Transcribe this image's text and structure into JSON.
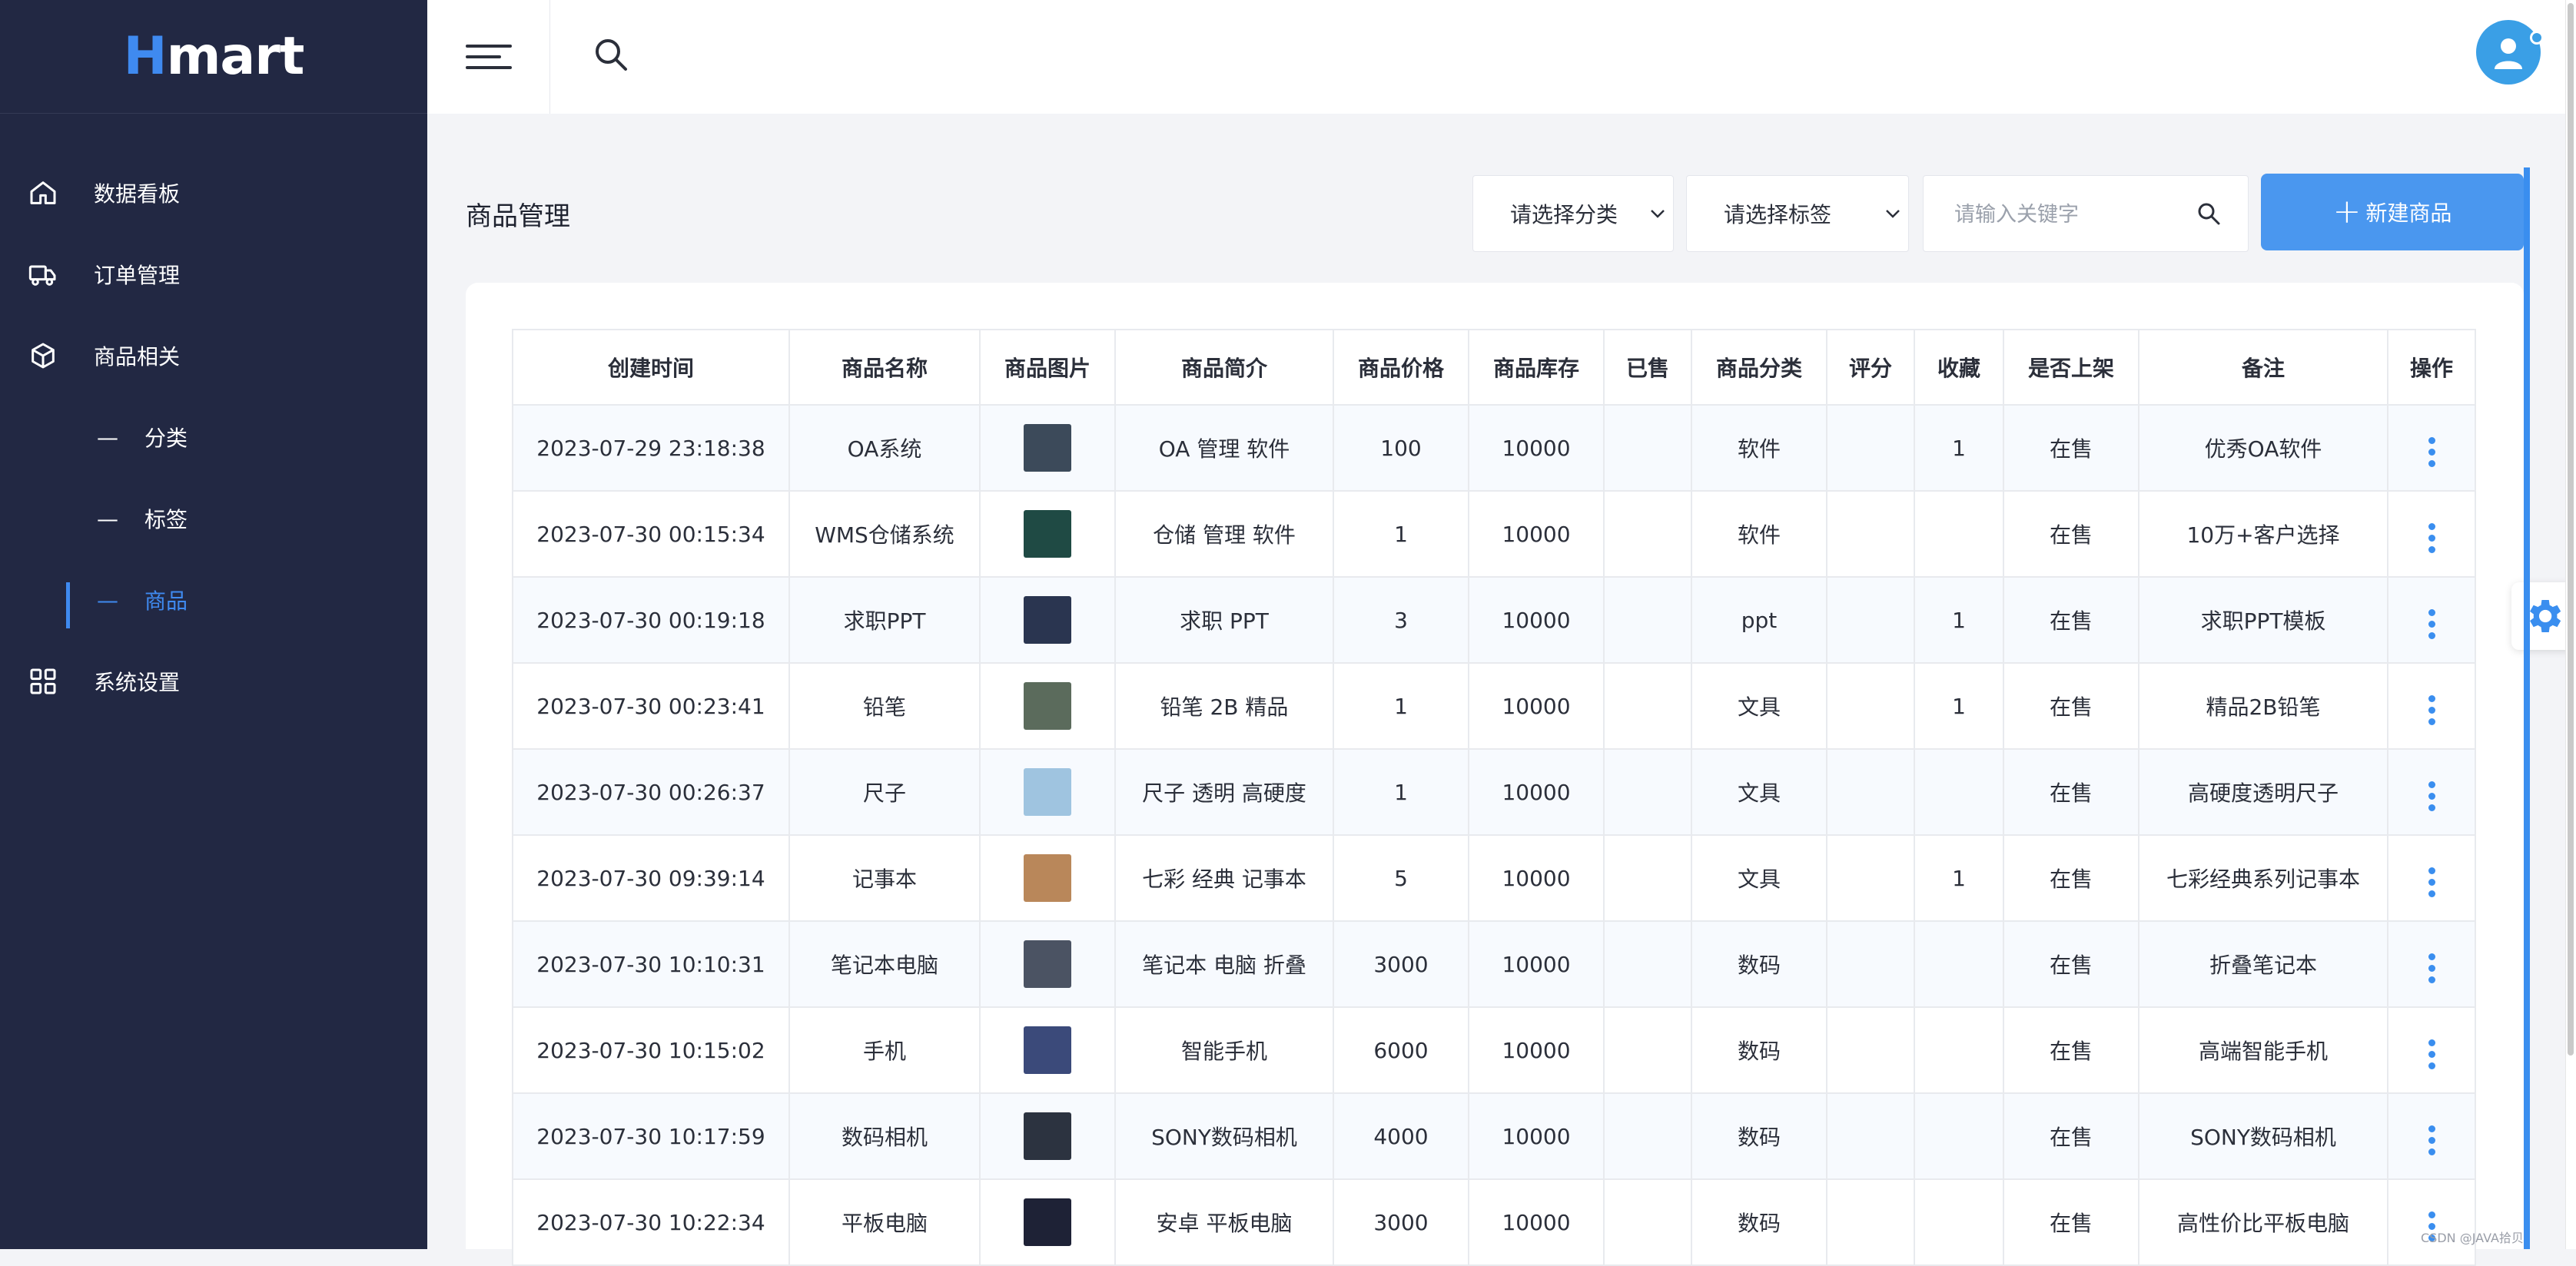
{
  "app": {
    "logo_h": "H",
    "logo_rest": "mart"
  },
  "sidebar": {
    "items": [
      {
        "label": "数据看板",
        "icon": "home-icon"
      },
      {
        "label": "订单管理",
        "icon": "truck-icon"
      },
      {
        "label": "商品相关",
        "icon": "cube-icon"
      }
    ],
    "sub_items": [
      {
        "dash": "—",
        "label": "分类"
      },
      {
        "dash": "—",
        "label": "标签"
      },
      {
        "dash": "—",
        "label": "商品",
        "active": true
      }
    ],
    "settings": {
      "label": "系统设置",
      "icon": "grid-icon"
    }
  },
  "page": {
    "title": "商品管理",
    "category_select": "请选择分类",
    "tag_select": "请选择标签",
    "search_placeholder": "请输入关键字",
    "new_button": "新建商品"
  },
  "table": {
    "columns": [
      "创建时间",
      "商品名称",
      "商品图片",
      "商品简介",
      "商品价格",
      "商品库存",
      "已售",
      "商品分类",
      "评分",
      "收藏",
      "是否上架",
      "备注",
      "操作"
    ],
    "rows": [
      {
        "time": "2023-07-29 23:18:38",
        "name": "OA系统",
        "desc": "OA 管理 软件",
        "price": "100",
        "stock": "10000",
        "sold": "",
        "category": "软件",
        "score": "",
        "fav": "1",
        "status": "在售",
        "note": "优秀OA软件",
        "thumb": "#3c4a5a"
      },
      {
        "time": "2023-07-30 00:15:34",
        "name": "WMS仓储系统",
        "desc": "仓储 管理 软件",
        "price": "1",
        "stock": "10000",
        "sold": "",
        "category": "软件",
        "score": "",
        "fav": "",
        "status": "在售",
        "note": "10万+客户选择",
        "thumb": "#1f4a44"
      },
      {
        "time": "2023-07-30 00:19:18",
        "name": "求职PPT",
        "desc": "求职 PPT",
        "price": "3",
        "stock": "10000",
        "sold": "",
        "category": "ppt",
        "score": "",
        "fav": "1",
        "status": "在售",
        "note": "求职PPT模板",
        "thumb": "#2a3550"
      },
      {
        "time": "2023-07-30 00:23:41",
        "name": "铅笔",
        "desc": "铅笔 2B 精品",
        "price": "1",
        "stock": "10000",
        "sold": "",
        "category": "文具",
        "score": "",
        "fav": "1",
        "status": "在售",
        "note": "精品2B铅笔",
        "thumb": "#5b6b5c"
      },
      {
        "time": "2023-07-30 00:26:37",
        "name": "尺子",
        "desc": "尺子 透明 高硬度",
        "price": "1",
        "stock": "10000",
        "sold": "",
        "category": "文具",
        "score": "",
        "fav": "",
        "status": "在售",
        "note": "高硬度透明尺子",
        "thumb": "#9fc4e0"
      },
      {
        "time": "2023-07-30 09:39:14",
        "name": "记事本",
        "desc": "七彩 经典 记事本",
        "price": "5",
        "stock": "10000",
        "sold": "",
        "category": "文具",
        "score": "",
        "fav": "1",
        "status": "在售",
        "note": "七彩经典系列记事本",
        "thumb": "#b9875a"
      },
      {
        "time": "2023-07-30 10:10:31",
        "name": "笔记本电脑",
        "desc": "笔记本 电脑 折叠",
        "price": "3000",
        "stock": "10000",
        "sold": "",
        "category": "数码",
        "score": "",
        "fav": "",
        "status": "在售",
        "note": "折叠笔记本",
        "thumb": "#4b5363"
      },
      {
        "time": "2023-07-30 10:15:02",
        "name": "手机",
        "desc": "智能手机",
        "price": "6000",
        "stock": "10000",
        "sold": "",
        "category": "数码",
        "score": "",
        "fav": "",
        "status": "在售",
        "note": "高端智能手机",
        "thumb": "#3b4a7a"
      },
      {
        "time": "2023-07-30 10:17:59",
        "name": "数码相机",
        "desc": "SONY数码相机",
        "price": "4000",
        "stock": "10000",
        "sold": "",
        "category": "数码",
        "score": "",
        "fav": "",
        "status": "在售",
        "note": "SONY数码相机",
        "thumb": "#2c3340"
      },
      {
        "time": "2023-07-30 10:22:34",
        "name": "平板电脑",
        "desc": "安卓 平板电脑",
        "price": "3000",
        "stock": "10000",
        "sold": "",
        "category": "数码",
        "score": "",
        "fav": "",
        "status": "在售",
        "note": "高性价比平板电脑",
        "thumb": "#1e2236"
      }
    ]
  },
  "watermark": "CSDN @JAVA拾贝",
  "colors": {
    "sidebar": "#222843",
    "accent": "#3f8af0",
    "button": "#4a97ef",
    "on_sale": "#2d9a3a"
  }
}
